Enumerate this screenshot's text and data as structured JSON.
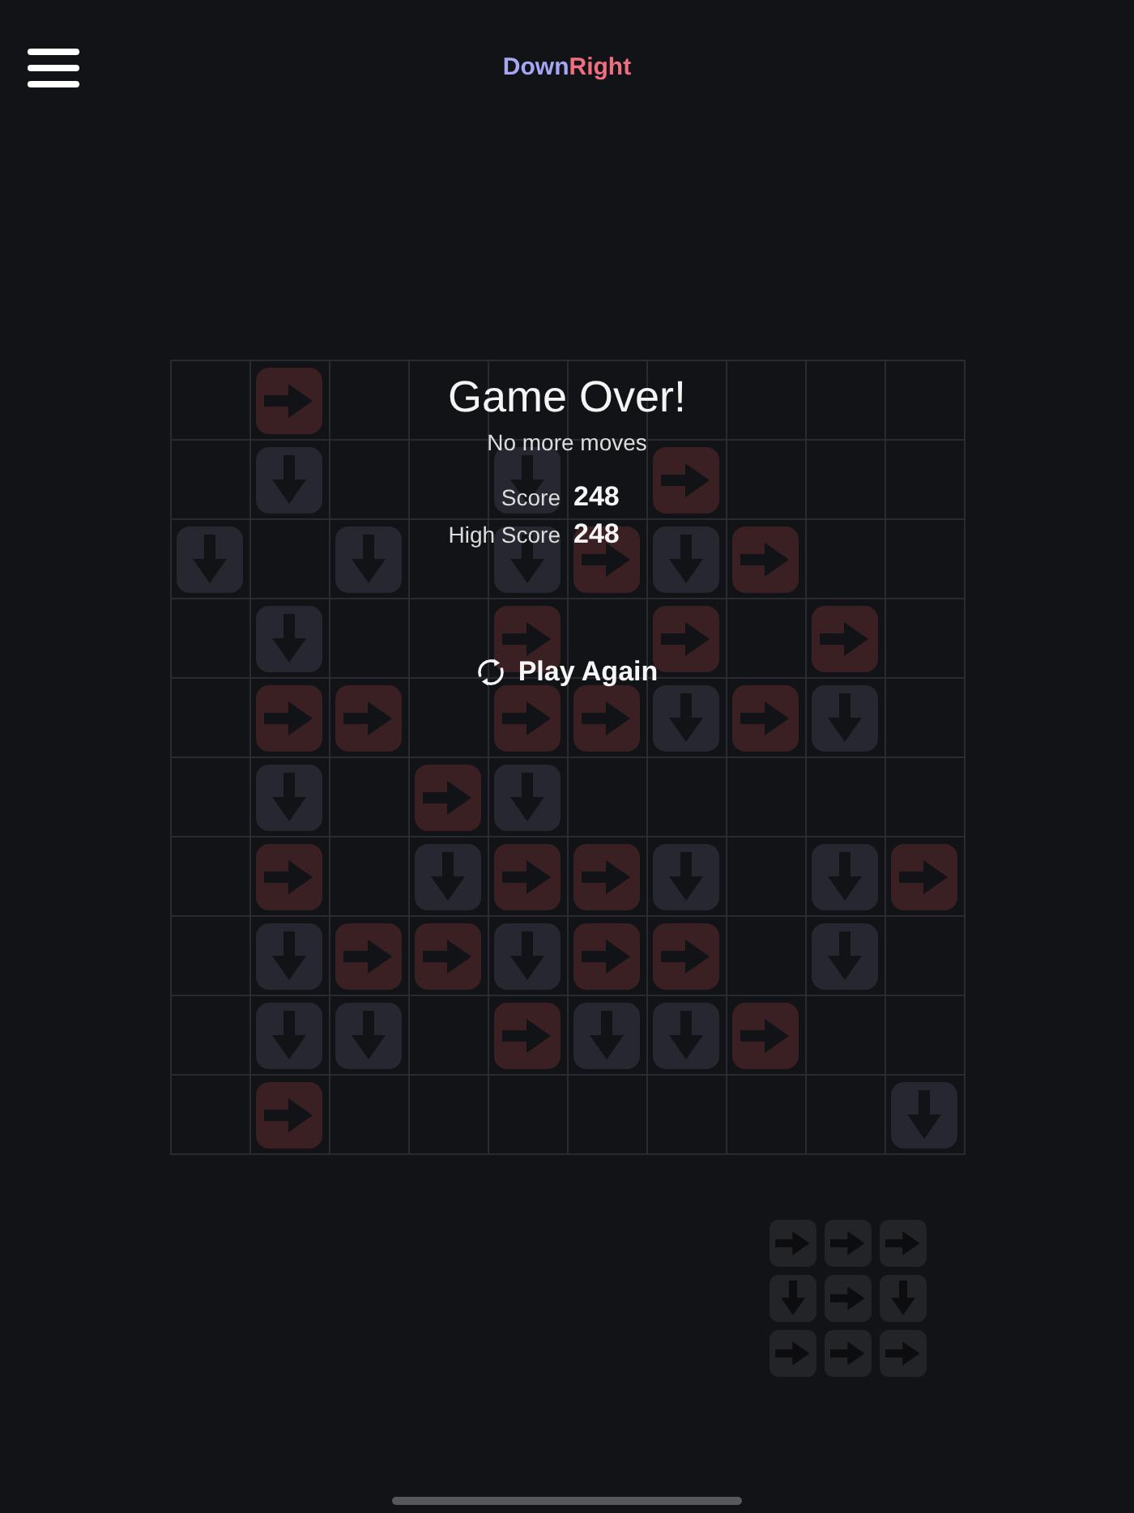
{
  "title": {
    "parts": [
      {
        "text": "Down",
        "color": "#a7a6f4"
      },
      {
        "text": "Right",
        "color": "#ef6f80"
      }
    ]
  },
  "board": {
    "rows": [
      [
        {
          "kind": "empty"
        },
        {
          "kind": "right"
        },
        {
          "kind": "empty"
        },
        {
          "kind": "empty"
        },
        {
          "kind": "empty"
        },
        {
          "kind": "empty"
        },
        {
          "kind": "empty"
        },
        {
          "kind": "empty"
        },
        {
          "kind": "empty"
        },
        {
          "kind": "empty"
        }
      ],
      [
        {
          "kind": "empty"
        },
        {
          "kind": "down"
        },
        {
          "kind": "empty"
        },
        {
          "kind": "empty"
        },
        {
          "kind": "down"
        },
        {
          "kind": "empty"
        },
        {
          "kind": "right"
        },
        {
          "kind": "empty"
        },
        {
          "kind": "empty"
        },
        {
          "kind": "empty"
        }
      ],
      [
        {
          "kind": "down"
        },
        {
          "kind": "empty"
        },
        {
          "kind": "down"
        },
        {
          "kind": "empty"
        },
        {
          "kind": "down"
        },
        {
          "kind": "right"
        },
        {
          "kind": "down"
        },
        {
          "kind": "right"
        },
        {
          "kind": "empty"
        },
        {
          "kind": "empty"
        }
      ],
      [
        {
          "kind": "empty"
        },
        {
          "kind": "down"
        },
        {
          "kind": "empty"
        },
        {
          "kind": "empty"
        },
        {
          "kind": "right"
        },
        {
          "kind": "empty"
        },
        {
          "kind": "right"
        },
        {
          "kind": "empty"
        },
        {
          "kind": "right"
        },
        {
          "kind": "empty"
        }
      ],
      [
        {
          "kind": "empty"
        },
        {
          "kind": "right"
        },
        {
          "kind": "right"
        },
        {
          "kind": "empty"
        },
        {
          "kind": "right"
        },
        {
          "kind": "right"
        },
        {
          "kind": "down"
        },
        {
          "kind": "right"
        },
        {
          "kind": "down"
        },
        {
          "kind": "empty"
        }
      ],
      [
        {
          "kind": "empty"
        },
        {
          "kind": "down"
        },
        {
          "kind": "empty"
        },
        {
          "kind": "right"
        },
        {
          "kind": "down"
        },
        {
          "kind": "empty"
        },
        {
          "kind": "empty"
        },
        {
          "kind": "empty"
        },
        {
          "kind": "empty"
        },
        {
          "kind": "empty"
        }
      ],
      [
        {
          "kind": "empty"
        },
        {
          "kind": "right"
        },
        {
          "kind": "empty"
        },
        {
          "kind": "down"
        },
        {
          "kind": "right"
        },
        {
          "kind": "right"
        },
        {
          "kind": "down"
        },
        {
          "kind": "empty"
        },
        {
          "kind": "down"
        },
        {
          "kind": "right"
        }
      ],
      [
        {
          "kind": "empty"
        },
        {
          "kind": "down"
        },
        {
          "kind": "right"
        },
        {
          "kind": "right"
        },
        {
          "kind": "down"
        },
        {
          "kind": "right"
        },
        {
          "kind": "right"
        },
        {
          "kind": "empty"
        },
        {
          "kind": "down"
        },
        {
          "kind": "empty"
        }
      ],
      [
        {
          "kind": "empty"
        },
        {
          "kind": "down"
        },
        {
          "kind": "down"
        },
        {
          "kind": "empty"
        },
        {
          "kind": "right"
        },
        {
          "kind": "down"
        },
        {
          "kind": "down"
        },
        {
          "kind": "right"
        },
        {
          "kind": "empty"
        },
        {
          "kind": "empty"
        }
      ],
      [
        {
          "kind": "empty"
        },
        {
          "kind": "right"
        },
        {
          "kind": "empty"
        },
        {
          "kind": "empty"
        },
        {
          "kind": "empty"
        },
        {
          "kind": "empty"
        },
        {
          "kind": "empty"
        },
        {
          "kind": "empty"
        },
        {
          "kind": "empty"
        },
        {
          "kind": "down"
        }
      ]
    ]
  },
  "game_over": {
    "title": "Game Over!",
    "message": "No more moves",
    "score_label": "Score",
    "score": "248",
    "high_score_label": "High Score",
    "high_score": "248",
    "play_again": "Play Again"
  },
  "next_piece": {
    "rows": [
      [
        {
          "kind": "right"
        },
        {
          "kind": "right"
        },
        {
          "kind": "right"
        }
      ],
      [
        {
          "kind": "down"
        },
        {
          "kind": "right"
        },
        {
          "kind": "down"
        }
      ],
      [
        {
          "kind": "right"
        },
        {
          "kind": "right"
        },
        {
          "kind": "right"
        }
      ]
    ]
  }
}
